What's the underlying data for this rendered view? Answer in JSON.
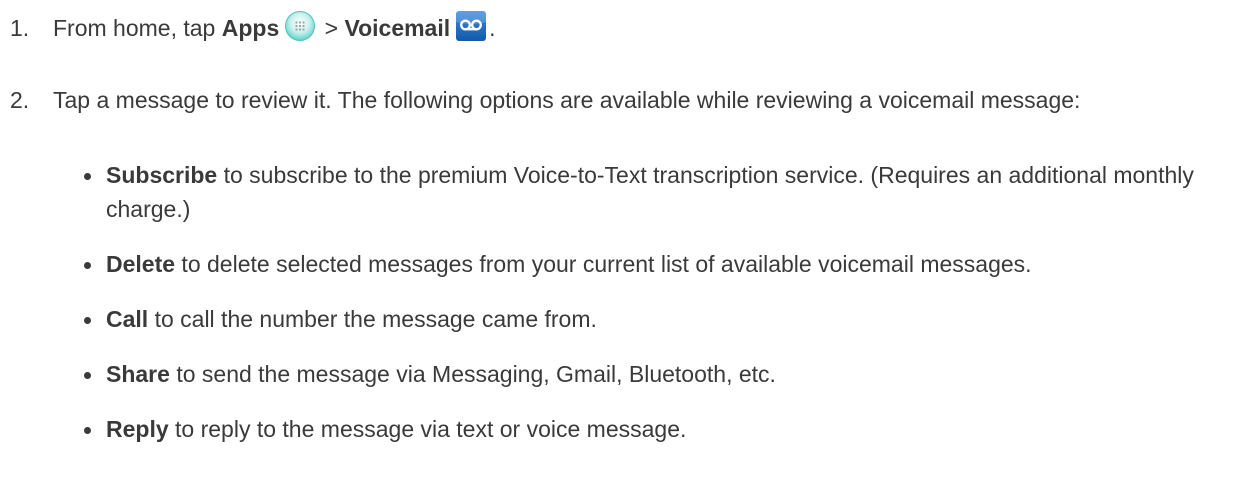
{
  "steps": [
    {
      "number": "1.",
      "prefix": "From home, tap ",
      "apps_label": "Apps",
      "separator": " > ",
      "voicemail_label": "Voicemail",
      "suffix": "."
    },
    {
      "number": "2.",
      "text": "Tap a message to review it. The following options are available while reviewing a voicemail message:"
    }
  ],
  "icons": {
    "apps": "apps-grid-icon",
    "voicemail": "voicemail-icon"
  },
  "colors": {
    "text": "#3a3a3a",
    "apps_icon": "#5fd0cb",
    "voicemail_icon": "#1d6fc4"
  },
  "options": [
    {
      "term": "Subscribe",
      "desc": " to subscribe to the premium Voice-to-Text transcription service. (Requires an additional monthly charge.)"
    },
    {
      "term": "Delete",
      "desc": " to delete selected messages from your current list of available voicemail messages."
    },
    {
      "term": "Call",
      "desc": " to call the number the message came from."
    },
    {
      "term": "Share",
      "desc": " to send the message via Messaging, Gmail, Bluetooth, etc."
    },
    {
      "term": "Reply",
      "desc": " to reply to the message via text or voice message."
    }
  ]
}
